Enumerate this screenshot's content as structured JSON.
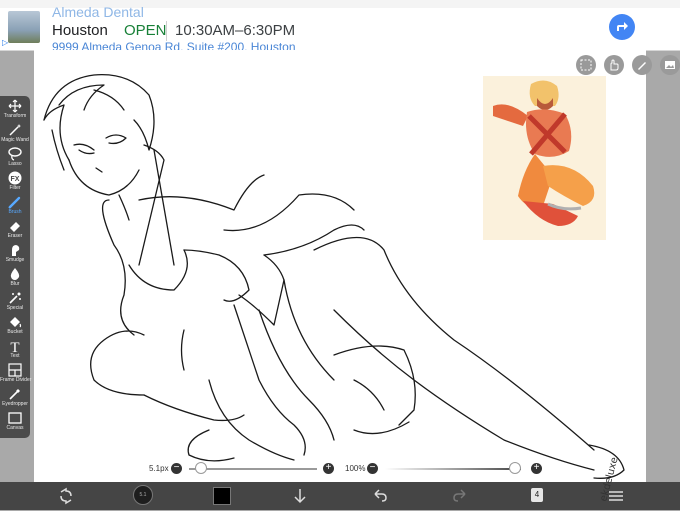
{
  "ad": {
    "brand": "Almeda Dental",
    "city": "Houston",
    "status": "OPEN",
    "hours": "10:30AM–6:30PM",
    "address": "9999 Almeda Genoa Rd, Suite #200, Houston",
    "flag": "▷",
    "colors": {
      "open": "#188038",
      "directions": "#4285f4"
    }
  },
  "toolbar": {
    "items": [
      {
        "label": "Transform",
        "icon": "move-icon"
      },
      {
        "label": "Magic Wand",
        "icon": "magic-wand-icon"
      },
      {
        "label": "Lasso",
        "icon": "lasso-icon"
      },
      {
        "label": "Filter",
        "icon": "fx-icon",
        "glyph": "FX"
      },
      {
        "label": "Brush",
        "icon": "brush-icon",
        "active": true
      },
      {
        "label": "Eraser",
        "icon": "eraser-icon"
      },
      {
        "label": "Smudge",
        "icon": "smudge-icon"
      },
      {
        "label": "Blur",
        "icon": "blur-drop-icon"
      },
      {
        "label": "Special",
        "icon": "special-wand-icon"
      },
      {
        "label": "Bucket",
        "icon": "bucket-icon"
      },
      {
        "label": "Text",
        "icon": "text-icon",
        "glyph": "T"
      },
      {
        "label": "Frame Divider",
        "icon": "frame-divider-icon"
      },
      {
        "label": "Eyedropper",
        "icon": "eyedropper-icon"
      },
      {
        "label": "Canvas",
        "icon": "canvas-icon"
      }
    ],
    "active_color": "#58a9ff"
  },
  "top_icons": [
    "selection-icon",
    "hand-icon",
    "pen-icon",
    "reference-image-icon"
  ],
  "sliders": {
    "brush_size": {
      "label": "5.1px",
      "value": 0.05
    },
    "opacity": {
      "label": "100%",
      "value": 1.0
    }
  },
  "bottom": {
    "brush_preview_text": "5.1",
    "color": "#000000",
    "layer_count": "4"
  },
  "signature": "ekdeluxe"
}
